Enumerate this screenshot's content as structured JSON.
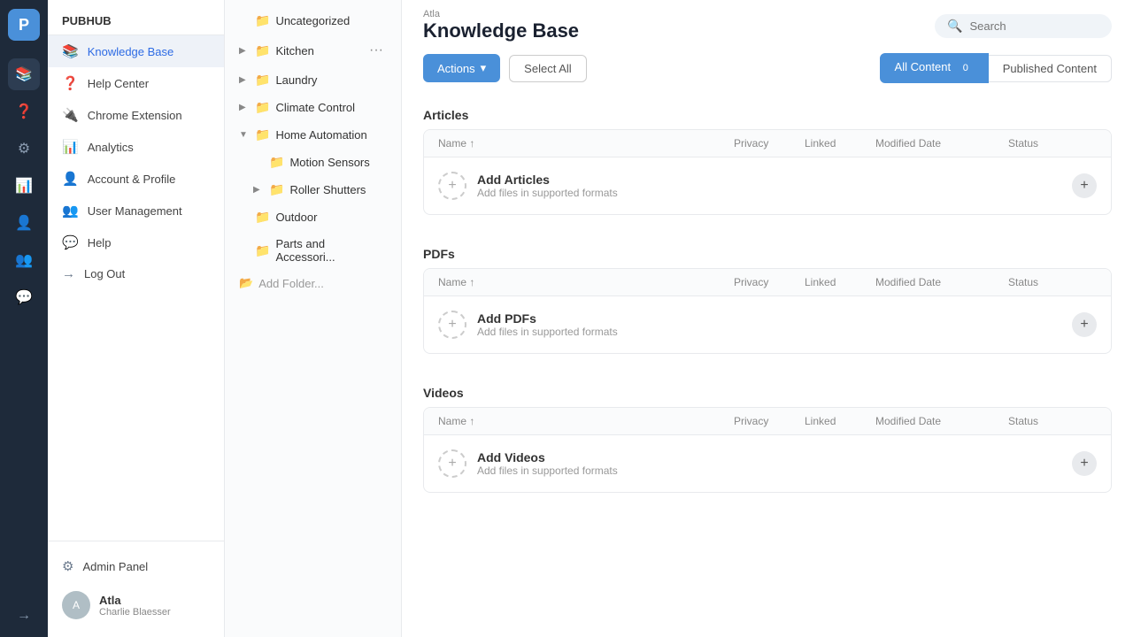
{
  "app": {
    "logo": "P",
    "name": "PUBHUB"
  },
  "rail": {
    "items": [
      {
        "icon": "⊞",
        "label": "dashboard-icon",
        "active": false
      },
      {
        "icon": "📚",
        "label": "knowledge-base-icon",
        "active": true
      },
      {
        "icon": "❓",
        "label": "help-center-icon",
        "active": false
      },
      {
        "icon": "🔌",
        "label": "chrome-extension-icon",
        "active": false
      },
      {
        "icon": "📊",
        "label": "analytics-icon",
        "active": false
      },
      {
        "icon": "👤",
        "label": "account-profile-icon",
        "active": false
      },
      {
        "icon": "👥",
        "label": "user-management-icon",
        "active": false
      },
      {
        "icon": "💬",
        "label": "help-icon",
        "active": false
      },
      {
        "icon": "→",
        "label": "logout-icon",
        "active": false
      }
    ]
  },
  "sidebar": {
    "items": [
      {
        "label": "Knowledge Base",
        "active": true
      },
      {
        "label": "Help Center",
        "active": false
      },
      {
        "label": "Chrome Extension",
        "active": false
      },
      {
        "label": "Analytics",
        "active": false
      },
      {
        "label": "Account & Profile",
        "active": false
      },
      {
        "label": "User Management",
        "active": false
      },
      {
        "label": "Help",
        "active": false
      },
      {
        "label": "Log Out",
        "active": false
      }
    ],
    "bottom": [
      {
        "label": "Admin Panel",
        "active": false
      }
    ],
    "user": {
      "name": "Atla",
      "email": "Charlie Blaesser"
    }
  },
  "folder_panel": {
    "items": [
      {
        "name": "Uncategorized",
        "color": "none",
        "level": 0,
        "chevron": false
      },
      {
        "name": "Kitchen",
        "color": "green",
        "level": 0,
        "chevron": true,
        "expanded": false,
        "more": true
      },
      {
        "name": "Laundry",
        "color": "yellow",
        "level": 0,
        "chevron": true,
        "expanded": false
      },
      {
        "name": "Climate Control",
        "color": "yellow",
        "level": 0,
        "chevron": true,
        "expanded": false
      },
      {
        "name": "Home Automation",
        "color": "green",
        "level": 0,
        "chevron": true,
        "expanded": true
      },
      {
        "name": "Motion Sensors",
        "color": "green",
        "level": 1,
        "chevron": false
      },
      {
        "name": "Roller Shutters",
        "color": "green",
        "level": 1,
        "chevron": true,
        "expanded": false
      },
      {
        "name": "Outdoor",
        "color": "green",
        "level": 0,
        "chevron": false
      },
      {
        "name": "Parts and Accessori...",
        "color": "green",
        "level": 0,
        "chevron": false
      }
    ],
    "add_folder_label": "Add Folder..."
  },
  "header": {
    "breadcrumb": "Atla",
    "title": "Knowledge Base",
    "search_placeholder": "Search"
  },
  "toolbar": {
    "actions_label": "Actions",
    "select_all_label": "Select All",
    "all_content_label": "All Content",
    "all_content_count": "0",
    "published_content_label": "Published Content"
  },
  "sections": [
    {
      "title": "Articles",
      "columns": [
        "Name",
        "Privacy",
        "Linked",
        "Modified Date",
        "Status"
      ],
      "add_title": "Add Articles",
      "add_subtitle": "Add files in supported formats"
    },
    {
      "title": "PDFs",
      "columns": [
        "Name",
        "Privacy",
        "Linked",
        "Modified Date",
        "Status"
      ],
      "add_title": "Add PDFs",
      "add_subtitle": "Add files in supported formats"
    },
    {
      "title": "Videos",
      "columns": [
        "Name",
        "Privacy",
        "Linked",
        "Modified Date",
        "Status"
      ],
      "add_title": "Add Videos",
      "add_subtitle": "Add files in supported formats"
    }
  ]
}
